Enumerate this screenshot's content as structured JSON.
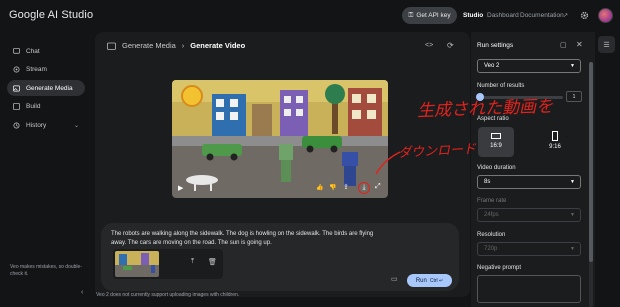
{
  "app": {
    "brand": "Google AI Studio"
  },
  "topbar": {
    "api_key": "Get API key",
    "nav": [
      "Studio",
      "Dashboard",
      "Documentation"
    ]
  },
  "sidebar": {
    "items": [
      {
        "label": "Chat",
        "icon": "chat-icon"
      },
      {
        "label": "Stream",
        "icon": "stream-icon"
      },
      {
        "label": "Generate Media",
        "icon": "media-icon"
      },
      {
        "label": "Build",
        "icon": "build-icon"
      },
      {
        "label": "History",
        "icon": "history-icon"
      }
    ],
    "footer": "Veo makes mistakes, so double-check it."
  },
  "breadcrumb": {
    "parent": "Generate Media",
    "current": "Generate Video"
  },
  "prompt": {
    "text": "The robots are walking along the sidewalk. The dog is howling on the sidewalk. The birds are flying away. The cars are moving on the road. The sun is going up.",
    "run": "Run",
    "shortcut": "Ctrl ↵"
  },
  "note": "Veo 2 does not currently support uploading images with children.",
  "run_settings": {
    "title": "Run settings",
    "model": "Veo 2",
    "results_label": "Number of results",
    "results_value": "1",
    "aspect_label": "Aspect ratio",
    "aspect_options": [
      "16:9",
      "9:16"
    ],
    "duration_label": "Video duration",
    "duration_value": "8s",
    "framerate_label": "Frame rate",
    "framerate_value": "24fps",
    "resolution_label": "Resolution",
    "resolution_value": "720p",
    "negative_label": "Negative prompt"
  },
  "annotation": {
    "line1": "生成された動画を",
    "line2": "ダウンロード",
    "color": "#e2221c"
  }
}
